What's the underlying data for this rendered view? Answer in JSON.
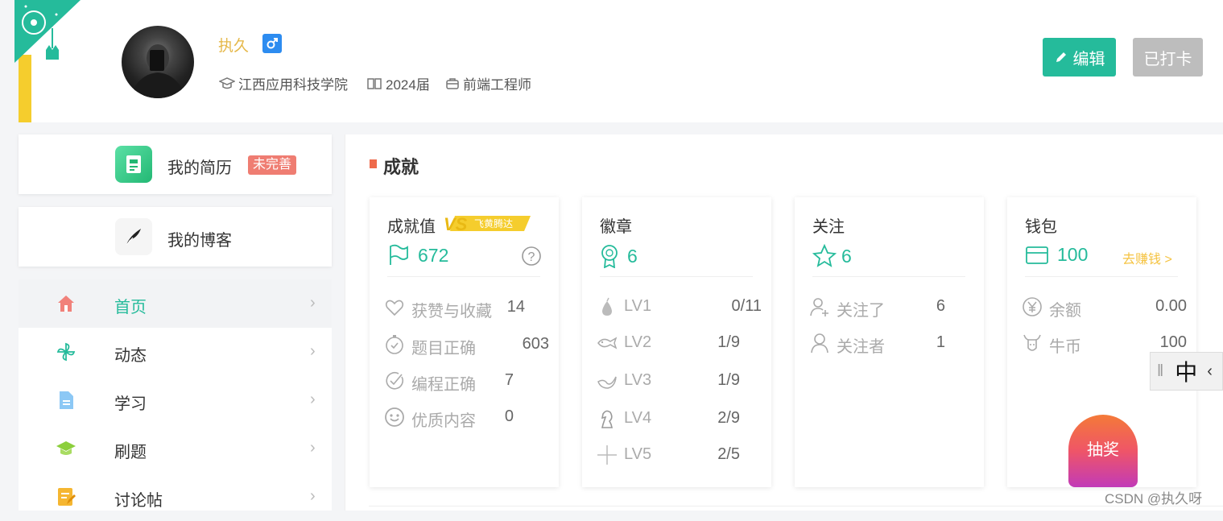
{
  "profile": {
    "username": "执久",
    "school": "江西应用科技学院",
    "graduation": "2024届",
    "position": "前端工程师",
    "edit_label": "编辑",
    "checkin_label": "已打卡"
  },
  "left_nav": {
    "resume_label": "我的简历",
    "resume_badge": "未完善",
    "blog_label": "我的博客",
    "items": [
      {
        "label": "首页",
        "icon": "home-icon"
      },
      {
        "label": "动态",
        "icon": "pinwheel-icon"
      },
      {
        "label": "学习",
        "icon": "document-icon"
      },
      {
        "label": "刷题",
        "icon": "graduation-cap-icon"
      },
      {
        "label": "讨论帖",
        "icon": "edit-note-icon"
      }
    ]
  },
  "achievements": {
    "section_title": "成就",
    "score": {
      "title": "成就值",
      "badge_text": "飞黄腾达",
      "value": "672",
      "rows": [
        {
          "label": "获赞与收藏",
          "value": "14"
        },
        {
          "label": "题目正确",
          "value": "603"
        },
        {
          "label": "编程正确",
          "value": "7"
        },
        {
          "label": "优质内容",
          "value": "0"
        }
      ]
    },
    "badges": {
      "title": "徽章",
      "value": "6",
      "rows": [
        {
          "label": "LV1",
          "value": "0/11"
        },
        {
          "label": "LV2",
          "value": "1/9"
        },
        {
          "label": "LV3",
          "value": "1/9"
        },
        {
          "label": "LV4",
          "value": "2/9"
        },
        {
          "label": "LV5",
          "value": "2/5"
        }
      ]
    },
    "follow": {
      "title": "关注",
      "value": "6",
      "rows": [
        {
          "label": "关注了",
          "value": "6"
        },
        {
          "label": "关注者",
          "value": "1"
        }
      ]
    },
    "wallet": {
      "title": "钱包",
      "value": "100",
      "earn_link": "去赚钱 >",
      "rows": [
        {
          "label": "余额",
          "value": "0.00"
        },
        {
          "label": "牛币",
          "value": "100"
        }
      ]
    }
  },
  "lottery_label": "抽奖",
  "ime_label": "中",
  "watermark": "CSDN @执久呀",
  "colors": {
    "accent": "#25bb9b",
    "badge_red": "#ef7d72",
    "name_gold": "#e5b84a",
    "gender_blue": "#2d8cf0"
  }
}
